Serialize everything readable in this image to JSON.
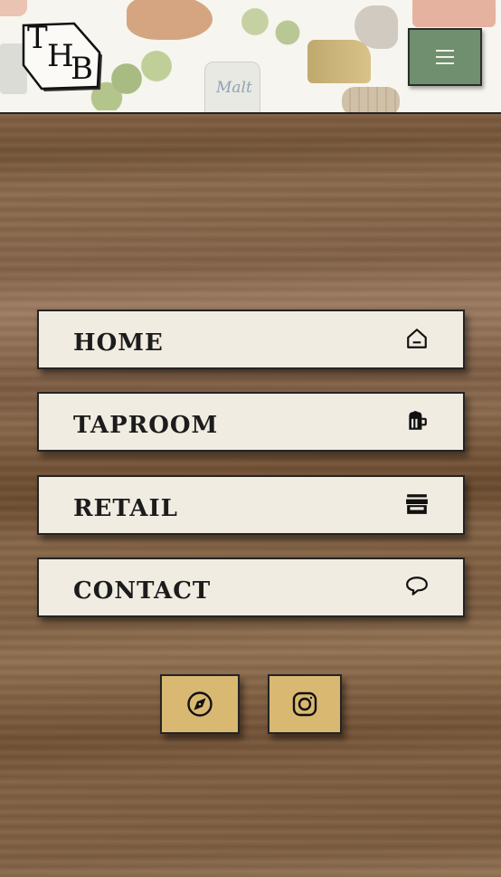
{
  "header": {
    "logo_letters": [
      "T",
      "H",
      "B"
    ],
    "illustration_text": "Malt",
    "menu_icon": "hamburger-icon"
  },
  "nav": {
    "items": [
      {
        "label": "HOME",
        "icon": "home-icon"
      },
      {
        "label": "TAPROOM",
        "icon": "beer-mug-icon"
      },
      {
        "label": "RETAIL",
        "icon": "storefront-icon"
      },
      {
        "label": "CONTACT",
        "icon": "speech-bubble-icon"
      }
    ]
  },
  "social": {
    "items": [
      {
        "icon": "compass-icon"
      },
      {
        "icon": "instagram-icon"
      }
    ]
  },
  "colors": {
    "menu_button": "#6f8f6e",
    "nav_background": "#f1ece2",
    "social_button": "#d9b872",
    "border": "#242424"
  }
}
